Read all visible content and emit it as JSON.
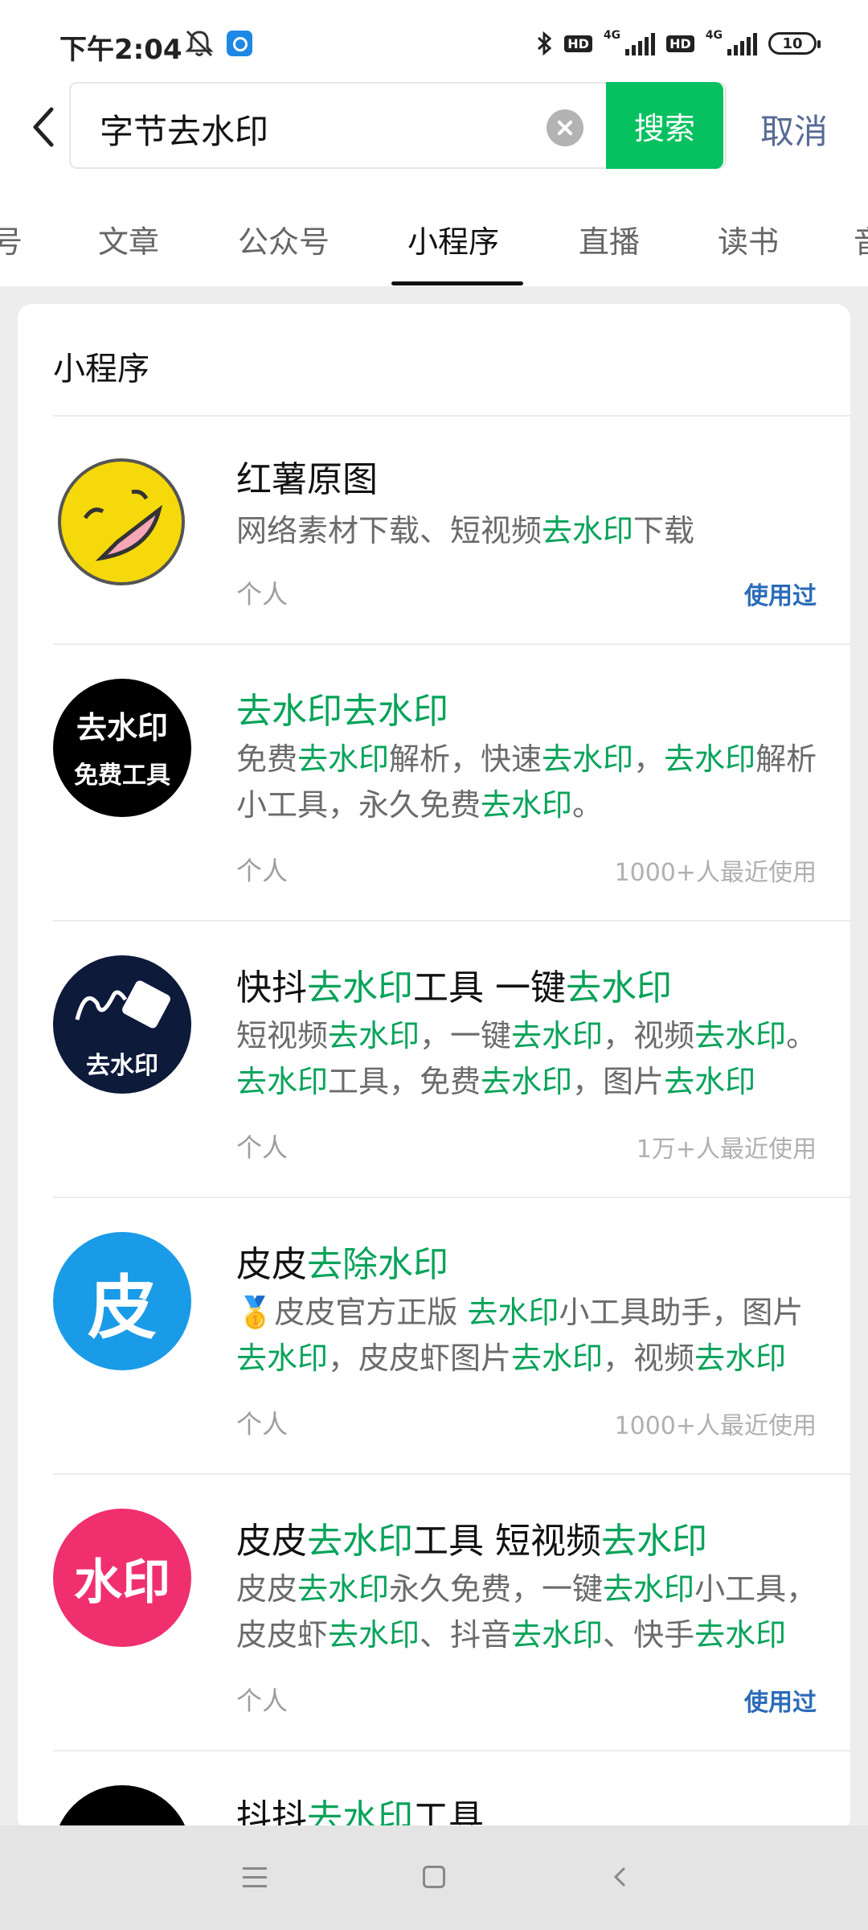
{
  "status_bar": {
    "time": "下午2:04",
    "network_label": "4G",
    "hd_label": "HD",
    "battery": "10"
  },
  "search": {
    "query": "字节去水印",
    "search_button": "搜索",
    "cancel_button": "取消"
  },
  "tabs": [
    {
      "label": "号"
    },
    {
      "label": "文章"
    },
    {
      "label": "公众号"
    },
    {
      "label": "小程序"
    },
    {
      "label": "直播"
    },
    {
      "label": "读书"
    },
    {
      "label": "音"
    }
  ],
  "active_tab": "小程序",
  "section_title": "小程序",
  "results": [
    {
      "title": "红薯原图",
      "desc": "网络素材下载、短视频去水印下载",
      "owner": "个人",
      "usage": "使用过"
    },
    {
      "title": "去水印去水印",
      "desc": "免费去水印解析，快速去水印，去水印解析小工具，永久免费去水印。",
      "owner": "个人",
      "usage": "1000+人最近使用",
      "avatar_text_line1": "去水印",
      "avatar_text_line2": "免费工具"
    },
    {
      "title": "快抖去水印工具 一键去水印",
      "desc": "短视频去水印，一键去水印，视频去水印。去水印工具，免费去水印，图片去水印",
      "owner": "个人",
      "usage": "1万+人最近使用",
      "avatar_text": "去水印"
    },
    {
      "title": "皮皮去除水印",
      "desc": "🥇皮皮官方正版 去水印小工具助手，图片去水印，皮皮虾图片去水印，视频去水印",
      "owner": "个人",
      "usage": "1000+人最近使用",
      "avatar_text": "皮"
    },
    {
      "title": "皮皮去水印工具 短视频去水印",
      "desc": "皮皮去水印永久免费，一键去水印小工具，皮皮虾去水印、抖音去水印、快手去水印",
      "owner": "个人",
      "usage": "使用过",
      "avatar_text": "水印"
    },
    {
      "title": "抖抖去水印工具"
    }
  ],
  "colors": {
    "accent_green": "#07c160",
    "highlight_green": "#07a35a",
    "link_blue": "#576b95",
    "used_blue": "#2b6bb8"
  }
}
